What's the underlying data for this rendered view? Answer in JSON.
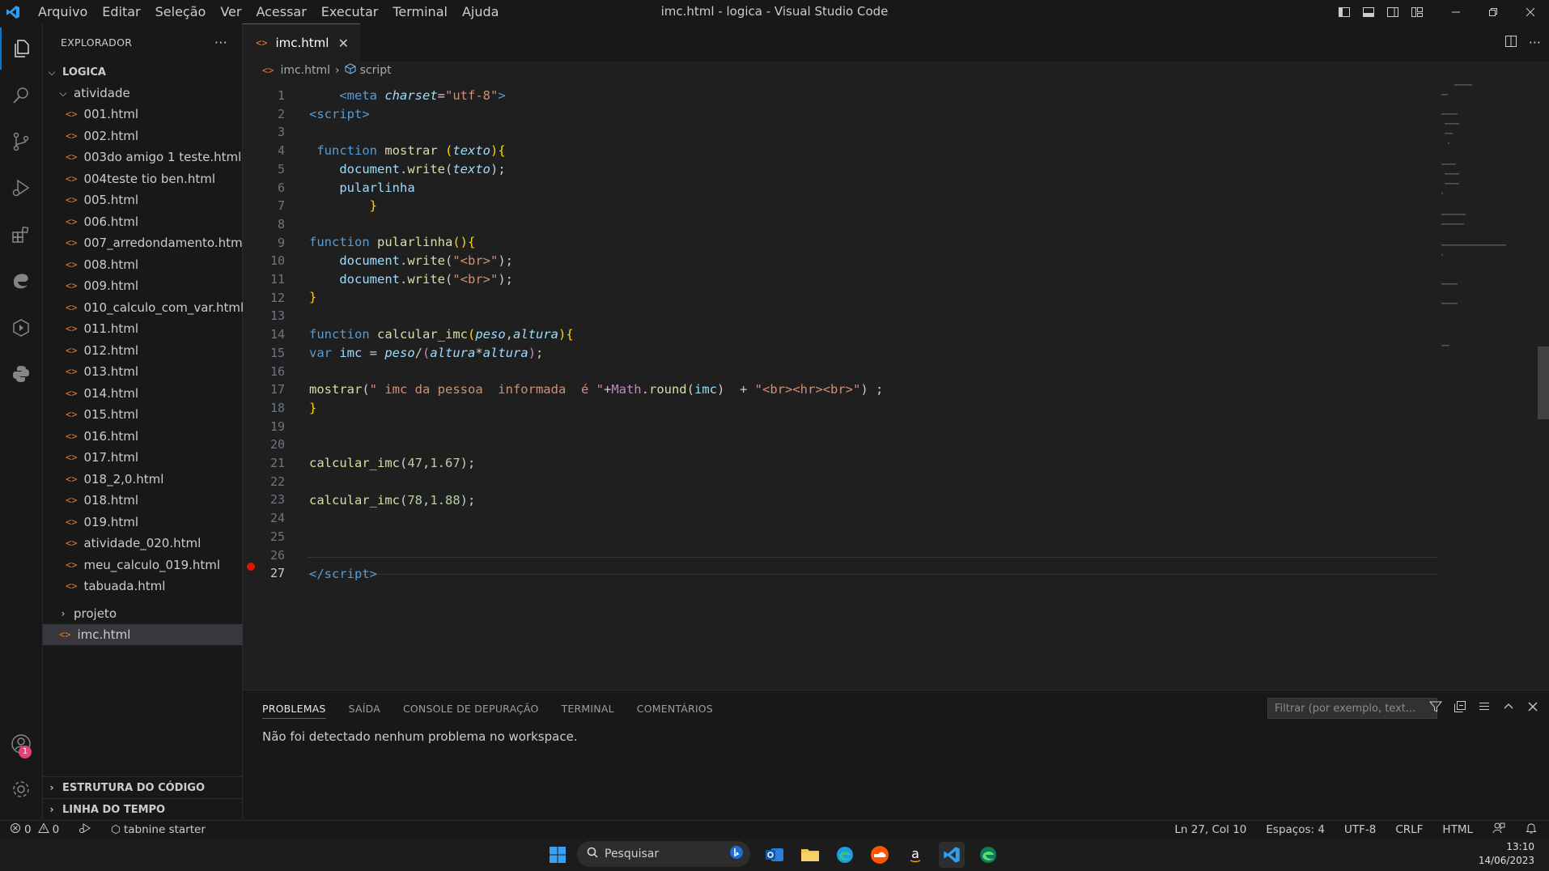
{
  "window": {
    "title": "imc.html - logica - Visual Studio Code"
  },
  "menu": [
    "Arquivo",
    "Editar",
    "Seleção",
    "Ver",
    "Acessar",
    "Executar",
    "Terminal",
    "Ajuda"
  ],
  "sidebar": {
    "header": "EXPLORADOR",
    "more": "···",
    "root": "LOGICA",
    "folder_open": "atividade",
    "files": [
      "001.html",
      "002.html",
      "003do amigo 1 teste.html",
      "004teste tio ben.html",
      "005.html",
      "006.html",
      "007_arredondamento.html",
      "008.html",
      "009.html",
      "010_calculo_com_var.html",
      "011.html",
      "012.html",
      "013.html",
      "014.html",
      "015.html",
      "016.html",
      "017.html",
      "018_2,0.html",
      "018.html",
      "019.html",
      "atividade_020.html",
      "meu_calculo_019.html",
      "tabuada.html"
    ],
    "folder_closed": "projeto",
    "selected_file": "imc.html",
    "outline": "ESTRUTURA DO CÓDIGO",
    "timeline": "LINHA DO TEMPO",
    "account_badge": "1"
  },
  "tab": {
    "label": "imc.html",
    "close": "✕"
  },
  "breadcrumb": {
    "file": "imc.html",
    "symbol": "script"
  },
  "editor": {
    "current_line": 27,
    "breakpoint_line": 27
  },
  "panel": {
    "tabs": [
      "PROBLEMAS",
      "SAÍDA",
      "CONSOLE DE DEPURAÇÃO",
      "TERMINAL",
      "COMENTÁRIOS"
    ],
    "active_tab": "PROBLEMAS",
    "filter_placeholder": "Filtrar (por exemplo, text...",
    "message": "Não foi detectado nenhum problema no workspace."
  },
  "status": {
    "errors": "0",
    "warnings": "0",
    "tabnine": "tabnine starter",
    "position": "Ln 27, Col 10",
    "spaces": "Espaços: 4",
    "encoding": "UTF-8",
    "eol": "CRLF",
    "language": "HTML"
  },
  "taskbar": {
    "search": "Pesquisar",
    "time": "13:10",
    "date": "14/06/2023"
  },
  "colors": {
    "accent": "#0078d4",
    "html_icon": "#e37933",
    "breakpoint": "#e51400",
    "badge": "#e5417d"
  }
}
